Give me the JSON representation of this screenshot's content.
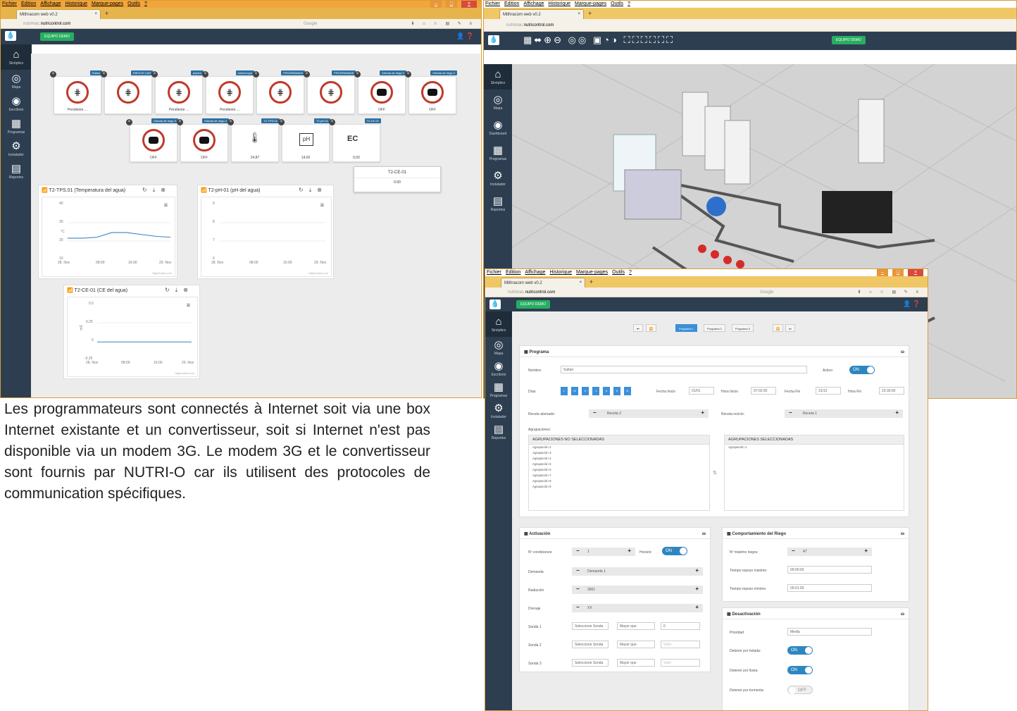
{
  "menu": [
    "Fichier",
    "Édition",
    "Affichage",
    "Historique",
    "Marque-pages",
    "Outils",
    "?"
  ],
  "tab_title": "Mithracom web v0.2",
  "url_light": "nutrimac.",
  "url_bold": "nutricontrol.com",
  "search_placeholder": "Google",
  "equipo": "EQUIPO DEMO",
  "sidebar": [
    "Sinóptico",
    "Mapa",
    "Escritorio",
    "Programas",
    "Instalador",
    "Reportes"
  ],
  "sidebar2": [
    "Sinóptico",
    "Mapa",
    "Dashboard",
    "Programas",
    "Instalador",
    "Reportes"
  ],
  "tiles_row1": [
    {
      "label": "Sultan",
      "caption": "Pendiente ..."
    },
    {
      "label": "RIEGOS CAR",
      "caption": ""
    },
    {
      "label": "pepino",
      "caption": "Pendiente ..."
    },
    {
      "label": "medra-topo",
      "caption": "Pendiente ..."
    },
    {
      "label": "PROGRAMA04",
      "caption": ""
    },
    {
      "label": "PROGRAMA05",
      "caption": ""
    },
    {
      "label": "Válvula de riego 1",
      "caption": "OFF"
    },
    {
      "label": "Válvula de riego 2",
      "caption": "OFF"
    }
  ],
  "tiles_row2": [
    {
      "label": "Válvula de riego 3",
      "caption": "OFF"
    },
    {
      "label": "Válvula de riego 4",
      "caption": "OFF"
    },
    {
      "label": "T2-TPS-01",
      "caption": "24,87"
    },
    {
      "label": "T2-pH-01",
      "caption": "14,00",
      "icon": "pH"
    },
    {
      "label": "T2-CE-01",
      "caption": "0,00",
      "icon": "EC"
    }
  ],
  "tooltip": {
    "title": "T2-CE-01",
    "value": "0.00"
  },
  "charts": [
    {
      "title": "T2-TPS.01 (Temperatura del agua)",
      "y": [
        "40",
        "30",
        "20",
        "10"
      ],
      "x": [
        "28. Nov",
        "08:00",
        "16:00",
        "29. Nov"
      ],
      "ylabel": "°C"
    },
    {
      "title": "T2-pH-01 (pH del agua)",
      "y": [
        "9",
        "8",
        "7",
        "6"
      ],
      "x": [
        "28. Nov",
        "08:00",
        "16:00",
        "29. Nov"
      ],
      "ylabel": ""
    },
    {
      "title": "T2-CE-01 (CE del agua)",
      "y": [
        "0.5",
        "0.25",
        "0",
        "-0.25"
      ],
      "x": [
        "28. Nov",
        "08:00",
        "16:00",
        "29. Nov"
      ],
      "ylabel": "mS"
    }
  ],
  "chart_data": [
    {
      "type": "line",
      "title": "T2-TPS.01 (Temperatura del agua)",
      "x": [
        "28. Nov",
        "08:00",
        "16:00",
        "29. Nov"
      ],
      "series": [
        {
          "values": [
            22,
            22,
            22.5,
            25,
            25,
            24,
            23,
            22.5
          ]
        }
      ],
      "ylim": [
        10,
        40
      ]
    },
    {
      "type": "line",
      "title": "T2-pH-01 (pH del agua)",
      "x": [
        "28. Nov",
        "08:00",
        "16:00",
        "29. Nov"
      ],
      "series": [],
      "ylim": [
        6,
        9
      ]
    },
    {
      "type": "line",
      "title": "T2-CE-01 (CE del agua)",
      "x": [
        "28. Nov",
        "08:00",
        "16:00",
        "29. Nov"
      ],
      "series": [
        {
          "values": [
            0,
            0,
            0,
            0,
            0,
            0,
            0,
            0
          ]
        }
      ],
      "ylim": [
        -0.25,
        0.5
      ]
    }
  ],
  "highcharts": "Highcharts.com",
  "paragraph": "Les programmateurs sont connectés à Internet soit via une box Internet existante et un convertisseur, soit si Internet n'est pas disponible via un modem 3G. Le modem 3G et le convertisseur sont fournis par NUTRI-O car ils utilisent des protocoles de communication spécifiques.",
  "prog": {
    "pages": [
      "Programa 1",
      "Programa 2",
      "Programa 3"
    ],
    "programa_title": "Programa",
    "nombre_label": "Nombre:",
    "nombre_value": "Sultan",
    "activo_label": "Activo:",
    "on": "ON",
    "off": "OFF",
    "dias_label": "Días:",
    "days": [
      "L",
      "M",
      "X",
      "J",
      "V",
      "S",
      "D"
    ],
    "fecha_inicio_label": "Fecha Inicio",
    "fecha_inicio": "01/01",
    "hora_inicio_label": "Hora Inicio",
    "hora_inicio": "07:02:55",
    "fecha_fin_label": "Fecha Fin",
    "fecha_fin": "31/12",
    "hora_fin_label": "Hora Fin",
    "hora_fin": "23:30:00",
    "receta_abonado_label": "Receta abonado:",
    "receta_abonado": "Receta 2",
    "receta_reciclo_label": "Receta reciclo:",
    "receta_reciclo": "Receta 1",
    "agrupaciones_label": "Agrupaciones:",
    "no_sel_header": "AGRUPACIONES NO SELECCIONADAS",
    "sel_header": "AGRUPACIONES SELECCIONADAS",
    "no_sel_items": [
      "Agrupación 2",
      "Agrupación 3",
      "Agrupación 4",
      "Agrupación 5",
      "Agrupación 6",
      "Agrupación 7",
      "Agrupación 8",
      "Agrupación 9"
    ],
    "sel_items": [
      "Agrupación 1"
    ],
    "activacion_title": "Activación",
    "n_cond_label": "Nº condiciones:",
    "n_cond": "1",
    "horario_label": "Horario:",
    "demanda_label": "Demanda",
    "demanda": "Demanda 1",
    "radiacion_label": "Radiación",
    "radiacion": "3001",
    "drenaje_label": "Drenaje",
    "drenaje": "XX",
    "sondas": [
      {
        "label": "Sonda 1",
        "sel": "Seleccione Sonda",
        "op": "Mayor que",
        "val": "0"
      },
      {
        "label": "Sonda 2",
        "sel": "Seleccione Sonda",
        "op": "Mayor que",
        "val": "Valor"
      },
      {
        "label": "Sonda 3",
        "sel": "Seleccione Sonda",
        "op": "Mayor que",
        "val": "Valor"
      }
    ],
    "comp_title": "Comportamiento del Riego",
    "n_max_label": "Nº máximo riegos:",
    "n_max": "47",
    "t_max_label": "Tiempo reposo máximo:",
    "t_max": "00:00:00",
    "t_min_label": "Tiempo reposo mínimo:",
    "t_min": "00:01:00",
    "desact_title": "Desactivación",
    "prioridad_label": "Prioridad",
    "prioridad": "Media",
    "helada_label": "Detener por helada:",
    "lluvia_label": "Detener por lluvia:",
    "tormenta_label": "Detener por tormenta:"
  }
}
